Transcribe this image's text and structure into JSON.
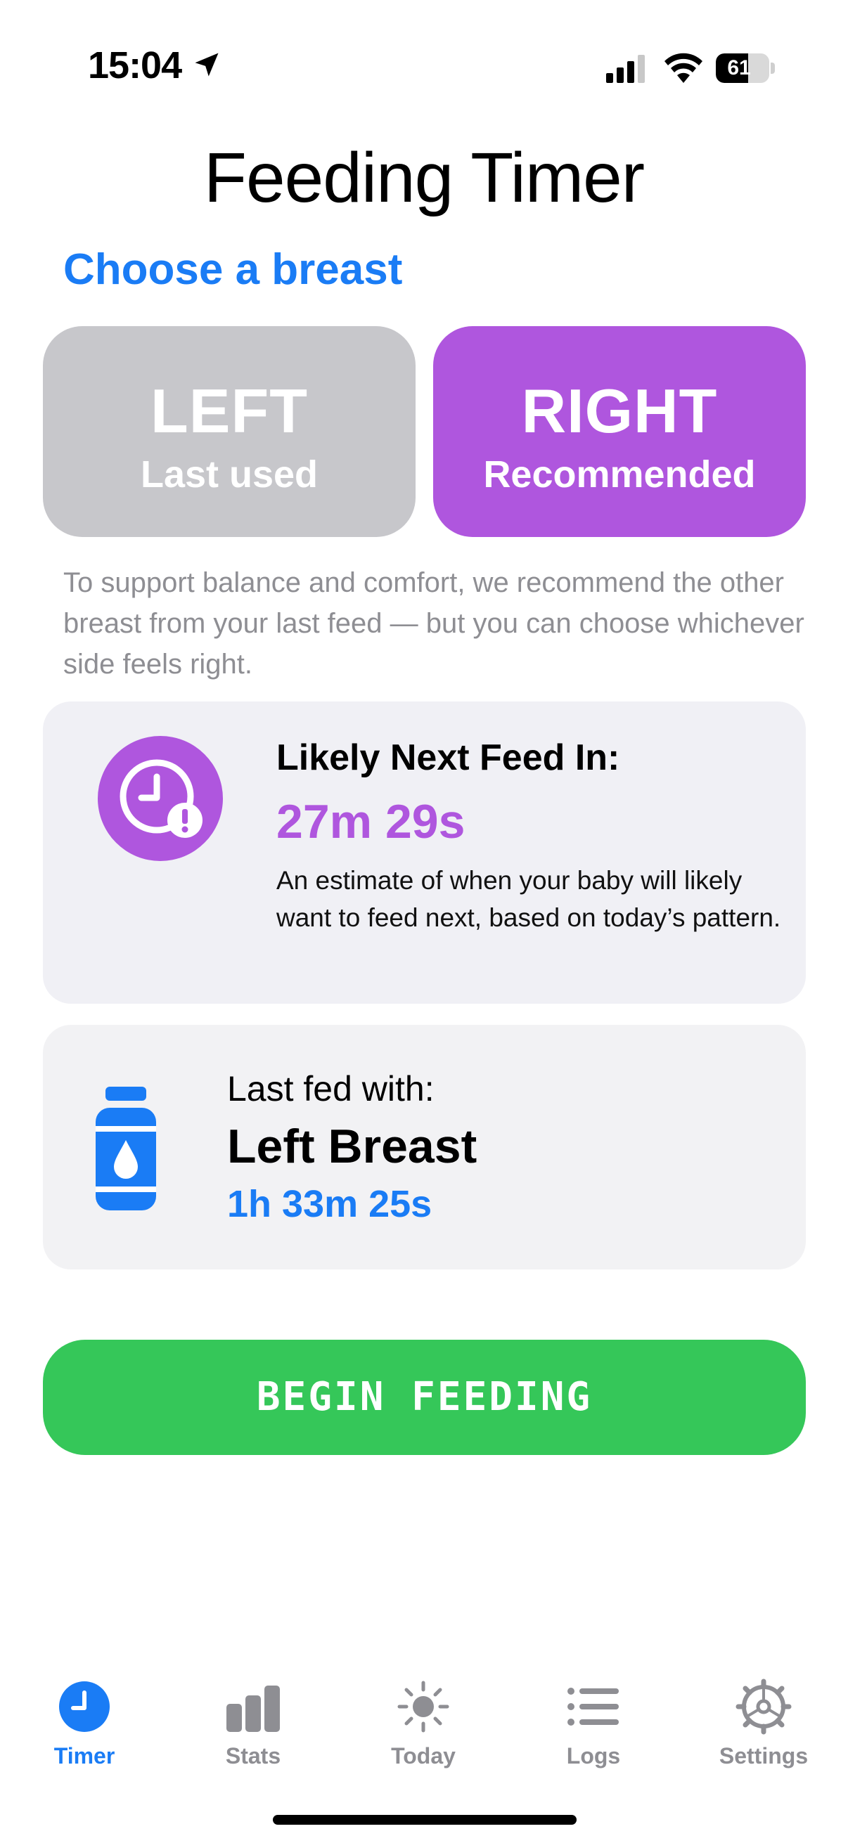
{
  "status_bar": {
    "time": "15:04",
    "battery": "61",
    "battery_level": 0.61
  },
  "title": "Feeding Timer",
  "section_heading": "Choose a breast",
  "choices": {
    "left": {
      "main": "LEFT",
      "sub": "Last used"
    },
    "right": {
      "main": "RIGHT",
      "sub": "Recommended"
    }
  },
  "explanation": "To support balance and comfort, we recommend the other breast from your last feed — but you can choose whichever side feels right.",
  "next_feed": {
    "label": "Likely Next Feed In:",
    "value": "27m 29s",
    "description": "An estimate of when your baby will likely want to feed next, based on today’s pattern."
  },
  "last_fed": {
    "label": "Last fed with:",
    "side": "Left Breast",
    "elapsed": "1h 33m 25s"
  },
  "begin_button": "BEGIN FEEDING",
  "tabs": [
    {
      "label": "Timer",
      "icon": "timer-icon",
      "active": true
    },
    {
      "label": "Stats",
      "icon": "bar-chart-icon",
      "active": false
    },
    {
      "label": "Today",
      "icon": "sun-icon",
      "active": false
    },
    {
      "label": "Logs",
      "icon": "list-icon",
      "active": false
    },
    {
      "label": "Settings",
      "icon": "gear-icon",
      "active": false
    }
  ],
  "colors": {
    "accent_blue": "#1a7cf5",
    "purple": "#af56de",
    "green": "#35c759",
    "gray_button": "#c7c7cb"
  }
}
